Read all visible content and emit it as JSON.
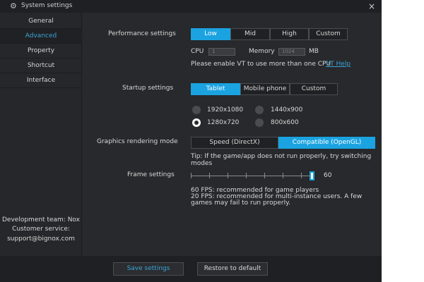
{
  "window": {
    "title": "System settings",
    "close_icon": "close-icon",
    "gear_icon": "gear-icon"
  },
  "sidebar": {
    "items": [
      {
        "label": "General"
      },
      {
        "label": "Advanced"
      },
      {
        "label": "Property"
      },
      {
        "label": "Shortcut"
      },
      {
        "label": "Interface"
      }
    ],
    "active": "Advanced",
    "dev_team": "Development team: Nox",
    "customer_service": "Customer service:",
    "email": "support@bignox.com"
  },
  "performance": {
    "label": "Performance settings",
    "options": [
      "Low",
      "Mid",
      "High",
      "Custom"
    ],
    "selected": "Low",
    "cpu_label": "CPU",
    "cpu_value": "1",
    "memory_label": "Memory",
    "memory_value": "1024",
    "memory_unit": "MB",
    "vt_note": "Please enable VT to use more than one CPU",
    "vt_link": "VT Help"
  },
  "startup": {
    "label": "Startup settings",
    "options": [
      "Tablet",
      "Mobile phone",
      "Custom"
    ],
    "selected": "Tablet",
    "resolutions": [
      "1920x1080",
      "1440x900",
      "1280x720",
      "800x600"
    ],
    "selected_resolution": "1280x720"
  },
  "graphics": {
    "label": "Graphics rendering mode",
    "options": [
      "Speed (DirectX)",
      "Compatible (OpenGL)"
    ],
    "selected": "Compatible (OpenGL)",
    "tip_line1": "Tip: If the game/app does not run properly, try switching",
    "tip_line2": "modes"
  },
  "frame": {
    "label": "Frame settings",
    "value": "60",
    "note1": "60 FPS: recommended for game players",
    "note2": "20 FPS: recommended for multi-instance users. A few",
    "note3": "games may fail to run properly."
  },
  "footer": {
    "save": "Save settings",
    "restore": "Restore to default"
  },
  "colors": {
    "accent": "#1aa3e0",
    "link": "#3aa4d6",
    "background": "#25272a"
  }
}
